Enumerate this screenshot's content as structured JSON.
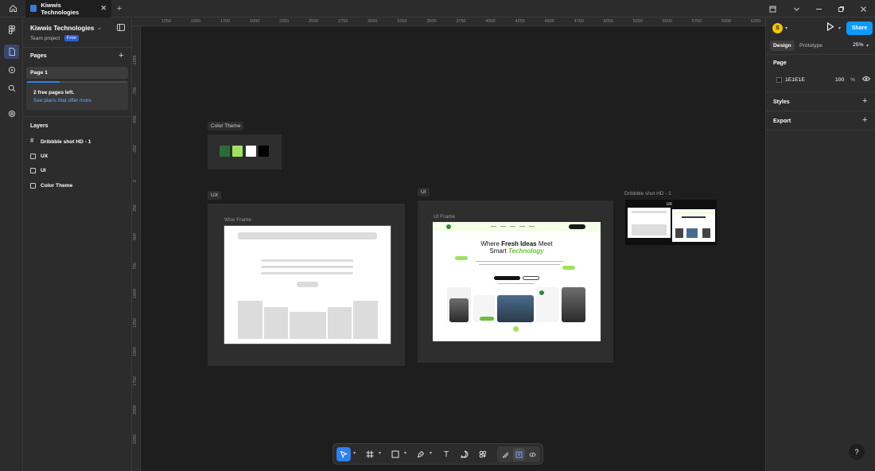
{
  "tabbar": {
    "home_icon": "home-icon",
    "tab_title": "Kiwwis Technologies",
    "close_glyph": "✕",
    "add_glyph": "+",
    "window_icons": [
      "notifications-icon",
      "chevron-down-icon",
      "minimize-icon",
      "restore-icon",
      "close-icon"
    ]
  },
  "rail": {
    "items": [
      "pages-icon",
      "assets-icon",
      "search-icon",
      "plugins-icon"
    ]
  },
  "left_panel": {
    "project_title": "Kiwwis Technologies",
    "project_sub": "Team project",
    "plan_badge": "Free",
    "pages_label": "Pages",
    "pages": [
      {
        "label": "Page 1"
      }
    ],
    "notice": {
      "title": "2 free pages left.",
      "link": "See plans that offer more",
      "progress": 0.33
    },
    "layers_label": "Layers",
    "layers": [
      {
        "label": "Dribbble shot HD - 1",
        "icon": "frame-icon"
      },
      {
        "label": "UX",
        "icon": "section-icon"
      },
      {
        "label": "UI",
        "icon": "section-icon"
      },
      {
        "label": "Color Theme",
        "icon": "section-icon"
      }
    ]
  },
  "rulers": {
    "top": [
      "1250",
      "1500",
      "1750",
      "2000",
      "2250",
      "2500",
      "2750",
      "3000",
      "3250",
      "3500",
      "3750",
      "4000",
      "4250",
      "4500",
      "4750",
      "5000",
      "5250",
      "5500",
      "5750",
      "6000",
      "6250"
    ],
    "left": [
      "-1000",
      "-750",
      "-500",
      "-250",
      "0",
      "250",
      "500",
      "750",
      "1000",
      "1250",
      "1500",
      "1750",
      "2000",
      "2250"
    ]
  },
  "canvas": {
    "color_theme_label": "Color Theme",
    "swatches": [
      "#2e6b3a",
      "#9ee35e",
      "#ffffff",
      "#000000"
    ],
    "ux_label": "UX",
    "wire_frame_label": "Wire Frame",
    "ui_label": "UI",
    "ui_frame_label": "UI Frame",
    "dribbble_label": "Dribbble shot HD - 1",
    "ui_heading_pre": "Where ",
    "ui_heading_bold": "Fresh Ideas",
    "ui_heading_post": " Meet",
    "ui_heading2_pre": "Smart ",
    "ui_heading2_accent": "Technology"
  },
  "toolbar": {
    "tools": [
      "move-tool-icon",
      "frame-tool-icon",
      "shape-tool-icon",
      "pen-tool-icon",
      "text-tool-icon",
      "comment-tool-icon",
      "components-icon",
      "draw-mode-icon",
      "design-mode-icon",
      "dev-mode-icon"
    ],
    "text_glyph": "T"
  },
  "right_panel": {
    "avatar_initial": "S",
    "share_label": "Share",
    "tab_design": "Design",
    "tab_prototype": "Prototype",
    "zoom": "25%",
    "page_section": "Page",
    "page_color": "1E1E1E",
    "page_opacity": "100",
    "page_pct": "%",
    "styles_label": "Styles",
    "export_label": "Export",
    "help": "?",
    "accent": "#0d99ff"
  }
}
